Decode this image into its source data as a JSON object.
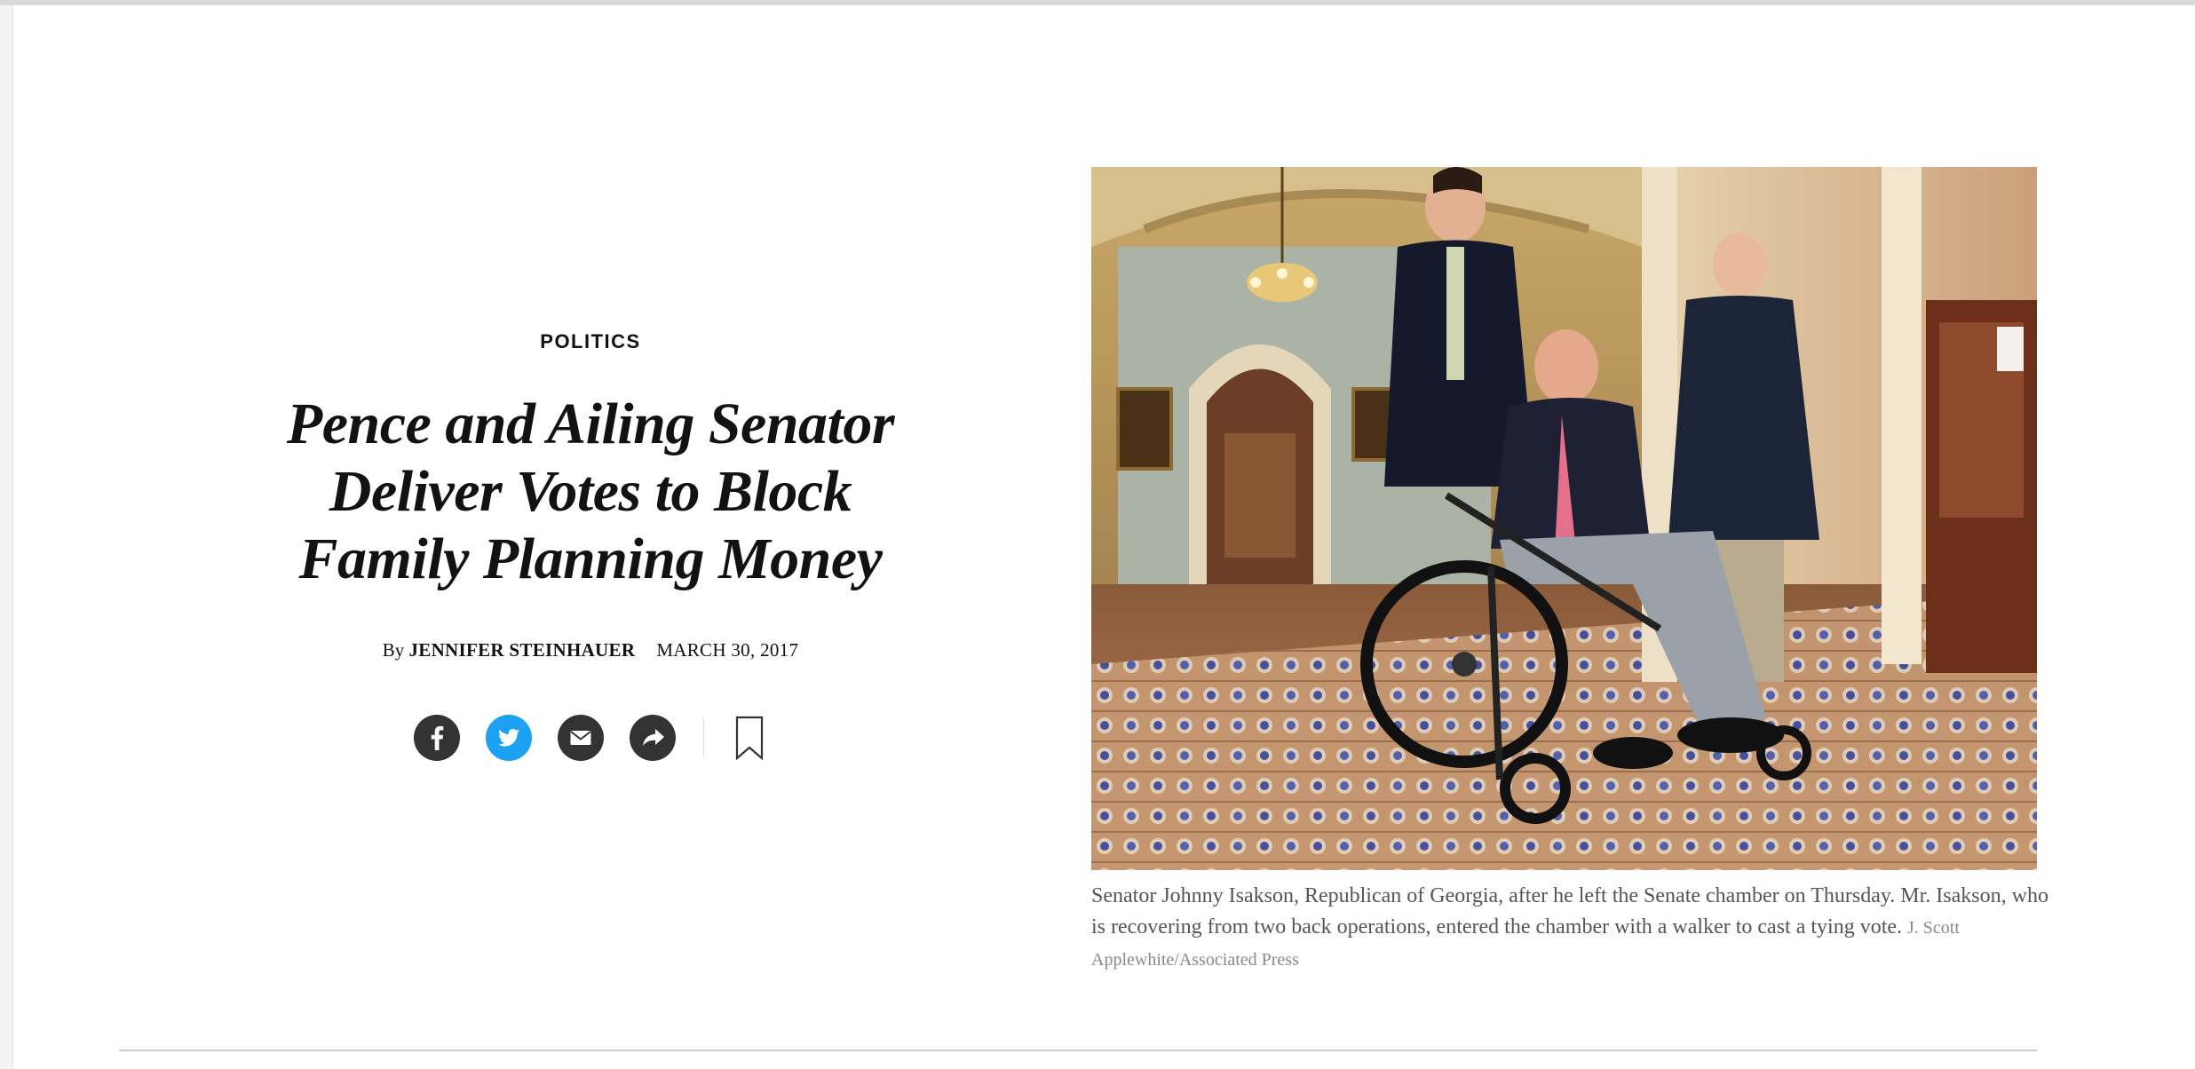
{
  "article": {
    "section": "POLITICS",
    "headline": "Pence and Ailing Senator Deliver Votes to Block Family Planning Money",
    "byline_prefix": "By",
    "author": "JENNIFER STEINHAUER",
    "date": "MARCH 30, 2017"
  },
  "share": {
    "icons": [
      "facebook-icon",
      "twitter-icon",
      "email-icon",
      "share-icon",
      "bookmark-icon"
    ],
    "twitter_color": "#1da1f2",
    "button_color": "#333333"
  },
  "figure": {
    "caption": "Senator Johnny Isakson, Republican of Georgia, after he left the Senate chamber on Thursday. Mr. Isakson, who is recovering from two back operations, entered the chamber with a walker to cast a tying vote.",
    "credit": "J. Scott Applewhite/Associated Press"
  }
}
